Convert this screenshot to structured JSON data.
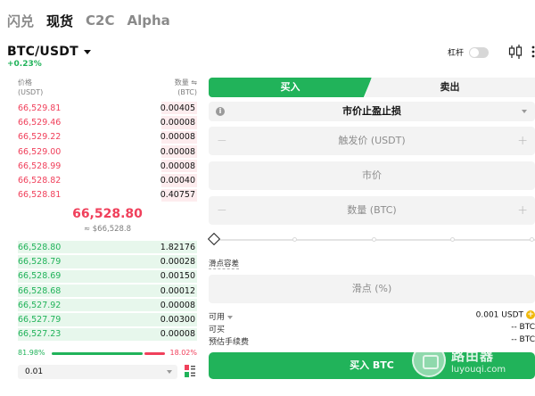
{
  "top_tabs": [
    "闪兑",
    "现货",
    "C2C",
    "Alpha"
  ],
  "active_tab": "现货",
  "pair": {
    "name": "BTC/USDT",
    "change": "+0.23%"
  },
  "leverage_label": "杠杆",
  "orderbook": {
    "price_header": "价格",
    "price_unit": "(USDT)",
    "qty_header": "数量 ⇋",
    "qty_unit": "(BTC)",
    "asks": [
      {
        "price": "66,529.81",
        "qty": "0.00405",
        "depth": 0.2
      },
      {
        "price": "66,529.46",
        "qty": "0.00008",
        "depth": 0.2
      },
      {
        "price": "66,529.22",
        "qty": "0.00008",
        "depth": 0.2
      },
      {
        "price": "66,529.00",
        "qty": "0.00008",
        "depth": 0.2
      },
      {
        "price": "66,528.99",
        "qty": "0.00008",
        "depth": 0.2
      },
      {
        "price": "66,528.82",
        "qty": "0.00040",
        "depth": 0.2
      },
      {
        "price": "66,528.81",
        "qty": "0.40757",
        "depth": 0.2
      }
    ],
    "mid_price": "66,528.80",
    "mid_sub": "≈ $66,528.8",
    "bids": [
      {
        "price": "66,528.80",
        "qty": "1.82176",
        "depth": 1.0
      },
      {
        "price": "66,528.79",
        "qty": "0.00028",
        "depth": 1.0
      },
      {
        "price": "66,528.69",
        "qty": "0.00150",
        "depth": 1.0
      },
      {
        "price": "66,528.68",
        "qty": "0.00012",
        "depth": 1.0
      },
      {
        "price": "66,527.92",
        "qty": "0.00008",
        "depth": 1.0
      },
      {
        "price": "66,527.79",
        "qty": "0.00300",
        "depth": 1.0
      },
      {
        "price": "66,527.23",
        "qty": "0.00008",
        "depth": 1.0
      }
    ],
    "buy_ratio": "81.98%",
    "sell_ratio": "18.02%",
    "buy_ratio_value": 81.98,
    "precision": "0.01"
  },
  "order": {
    "buy_tab": "买入",
    "sell_tab": "卖出",
    "order_type": "市价止盈止损",
    "trigger_placeholder": "触发价 (USDT)",
    "market_label": "市价",
    "amount_placeholder": "数量 (BTC)",
    "slippage_label": "滑点容差",
    "slippage_placeholder": "滑点 (%)",
    "available_label": "可用",
    "available_value": "0.001 USDT",
    "can_buy_label": "可买",
    "can_buy_value": "-- BTC",
    "fee_label": "预估手续费",
    "fee_value": "-- BTC",
    "submit_label": "买入 BTC"
  },
  "watermark": {
    "brand": "路由器",
    "site": "luyouqi.com"
  },
  "colors": {
    "buy": "#21b35a",
    "sell": "#f0405b"
  }
}
